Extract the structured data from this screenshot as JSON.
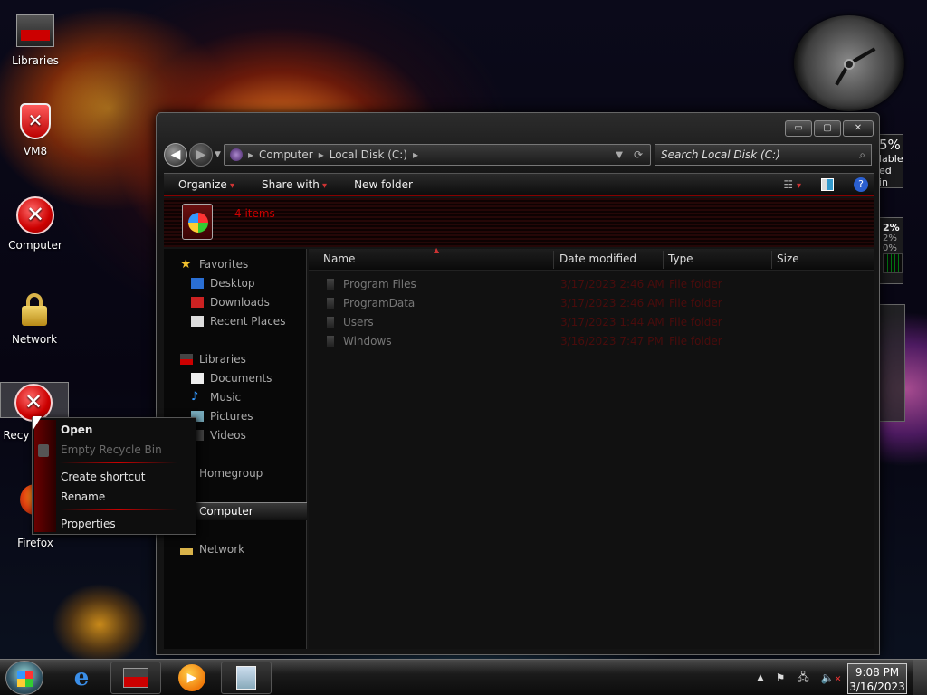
{
  "desktop": {
    "icons": [
      {
        "label": "Libraries"
      },
      {
        "label": "VM8"
      },
      {
        "label": "Computer"
      },
      {
        "label": "Network"
      },
      {
        "label": "Recy"
      },
      {
        "label": "M\nFirefox"
      }
    ]
  },
  "gadgets": {
    "cpu_percent": "2%",
    "cpu_core1": "2%",
    "cpu_core2": "0%",
    "disk_percent": "5%",
    "disk_line1": "lable",
    "disk_line2": "ed in"
  },
  "explorer": {
    "window_controls": {
      "minimize": "▭",
      "maximize": "▢",
      "close": "✕"
    },
    "nav": {
      "back": "◀",
      "forward": "▶"
    },
    "breadcrumb": [
      "Computer",
      "Local Disk (C:)"
    ],
    "search_placeholder": "Search Local Disk (C:)",
    "toolbar": {
      "organize": "Organize",
      "share_with": "Share with",
      "new_folder": "New folder"
    },
    "item_count": "4 items",
    "nav_pane": {
      "favorites": "Favorites",
      "desktop": "Desktop",
      "downloads": "Downloads",
      "recent_places": "Recent Places",
      "libraries": "Libraries",
      "documents": "Documents",
      "music": "Music",
      "pictures": "Pictures",
      "videos": "Videos",
      "homegroup": "Homegroup",
      "computer": "Computer",
      "network": "Network"
    },
    "columns": {
      "name": "Name",
      "date_modified": "Date modified",
      "type": "Type",
      "size": "Size"
    },
    "files": [
      {
        "name": "Program Files",
        "date": "3/17/2023 2:46 AM",
        "type": "File folder"
      },
      {
        "name": "ProgramData",
        "date": "3/17/2023 2:46 AM",
        "type": "File folder"
      },
      {
        "name": "Users",
        "date": "3/17/2023 1:44 AM",
        "type": "File folder"
      },
      {
        "name": "Windows",
        "date": "3/16/2023 7:47 PM",
        "type": "File folder"
      }
    ]
  },
  "context_menu": {
    "open": "Open",
    "empty_recycle_bin": "Empty Recycle Bin",
    "create_shortcut": "Create shortcut",
    "rename": "Rename",
    "properties": "Properties"
  },
  "taskbar": {
    "time": "9:08 PM",
    "date": "3/16/2023",
    "tray_arrow": "▲"
  }
}
